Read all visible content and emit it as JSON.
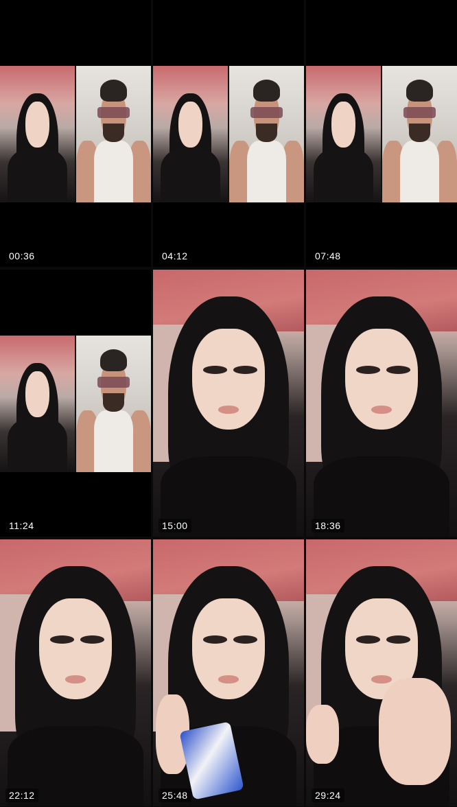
{
  "thumbnails": [
    {
      "timestamp": "00:36",
      "layout": "split"
    },
    {
      "timestamp": "04:12",
      "layout": "split"
    },
    {
      "timestamp": "07:48",
      "layout": "split"
    },
    {
      "timestamp": "11:24",
      "layout": "split"
    },
    {
      "timestamp": "15:00",
      "layout": "full"
    },
    {
      "timestamp": "18:36",
      "layout": "full"
    },
    {
      "timestamp": "22:12",
      "layout": "full"
    },
    {
      "timestamp": "25:48",
      "layout": "full"
    },
    {
      "timestamp": "29:24",
      "layout": "full"
    }
  ],
  "colors": {
    "background": "#000000",
    "timestamp_text": "#ffffff",
    "ceiling_red": "#c86b6c"
  }
}
